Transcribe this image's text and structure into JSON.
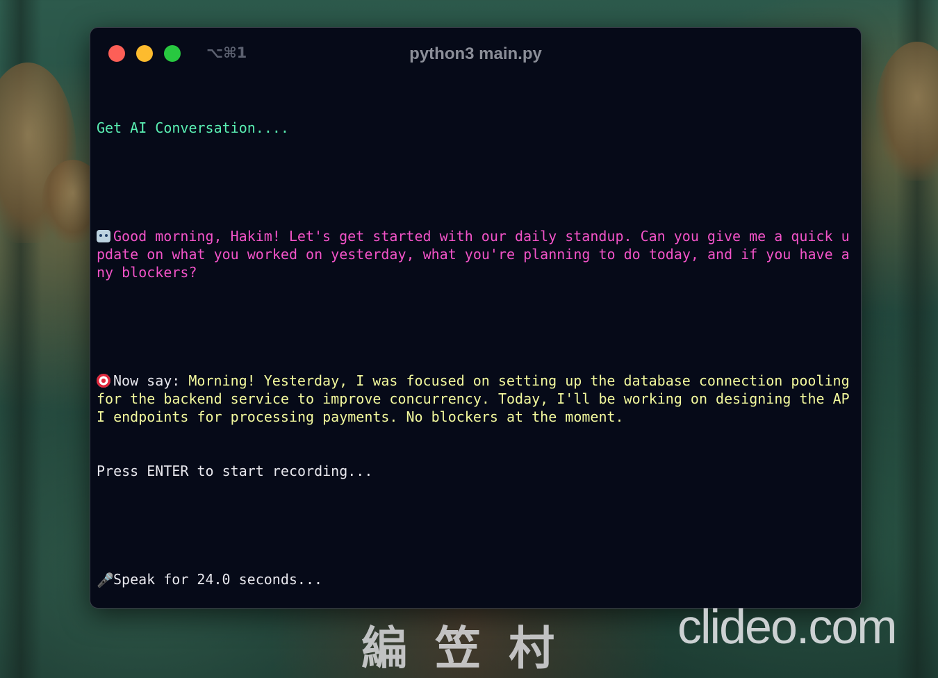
{
  "window": {
    "title": "python3 main.py",
    "tab_shortcut": "⌥⌘1",
    "controls": {
      "close_color": "#fd5f57",
      "minimize_color": "#fdbb2e",
      "maximize_color": "#28c840"
    }
  },
  "terminal": {
    "lines": {
      "header": "Get AI Conversation....",
      "ai_prompt_icon": "robot-icon",
      "ai_prompt": "Good morning, Hakim! Let's get started with our daily standup. Can you give me a quick update on what you worked on yesterday, what you're planning to do today, and if you have any blockers?",
      "say_icon": "target-icon",
      "say_label": "Now say: ",
      "say_text": "Morning! Yesterday, I was focused on setting up the database connection pooling for the backend service to improve concurrency. Today, I'll be working on designing the API endpoints for processing payments. No blockers at the moment.",
      "press_enter": "Press ENTER to start recording...",
      "speak_icon": "microphone-icon",
      "speak": "Speak for 24.0 seconds..."
    },
    "colors": {
      "background": "#060a18",
      "header": "#5af0b3",
      "ai_prompt": "#f253c8",
      "say_text": "#f3f99d",
      "default_text": "#e8e8ee",
      "cursor": "#5af0b3"
    }
  },
  "watermarks": {
    "cjk": "編笠村",
    "brand": "clideo.com"
  }
}
